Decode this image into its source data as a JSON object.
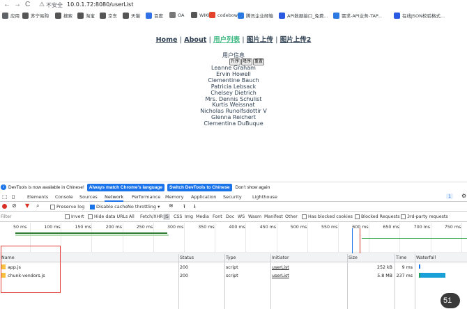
{
  "browser": {
    "nav": {
      "back": "←",
      "forward": "→",
      "reload": "C"
    },
    "security_label": "不安全",
    "url": "10.0.1.72:8080/userList",
    "bookmarks": [
      {
        "label": "应用",
        "color": "#5f6368"
      },
      {
        "label": "苏宁易购",
        "color": "#555"
      },
      {
        "label": "搜索",
        "color": "#555"
      },
      {
        "label": "淘宝",
        "color": "#555"
      },
      {
        "label": "京东",
        "color": "#555"
      },
      {
        "label": "天猫",
        "color": "#555"
      },
      {
        "label": "百度",
        "color": "#3072e6"
      },
      {
        "label": "OA",
        "color": "#777"
      },
      {
        "label": "WIKI",
        "color": "#555"
      },
      {
        "label": "codebowl",
        "color": "#e2432a"
      },
      {
        "label": "腾讯企业邮箱",
        "color": "#2a7ae2"
      },
      {
        "label": "API数据接口_免费...",
        "color": "#2a5ae2"
      },
      {
        "label": "需求-API业务-TAP...",
        "color": "#2a7ae2"
      },
      {
        "label": "在线JSON校验格式...",
        "color": "#2a5ae2"
      }
    ]
  },
  "page": {
    "nav": [
      {
        "label": "Home",
        "active": false
      },
      {
        "label": "About",
        "active": false
      },
      {
        "label": "用户列表",
        "active": true
      },
      {
        "label": "图片上传",
        "active": false
      },
      {
        "label": "图片上传2",
        "active": false
      }
    ],
    "nav_separator": "|",
    "user_title": "用户信息",
    "buttons": [
      "升序",
      "降序",
      "重置"
    ],
    "users": [
      "Leanne Graham",
      "Ervin Howell",
      "Clementine Bauch",
      "Patricia Lebsack",
      "Chelsey Dietrich",
      "Mrs. Dennis Schulist",
      "Kurtis Weissnat",
      "Nicholas Runolfsdottir V",
      "Glenna Reichert",
      "Clementina DuBuque"
    ]
  },
  "notice": {
    "text": "DevTools is now available in Chinese!",
    "btn_match": "Always match Chrome's language",
    "btn_switch": "Switch DevTools to Chinese",
    "dont_show": "Don't show again"
  },
  "devtools": {
    "tabs": [
      "Elements",
      "Console",
      "Sources",
      "Network",
      "Performance",
      "Memory",
      "Application",
      "Security",
      "Lighthouse"
    ],
    "active_tab": "Network",
    "messages_count": "1",
    "toolbar": {
      "preserve_log": "Preserve log",
      "disable_cache": "Disable cache",
      "throttle": "No throttling"
    },
    "filter": {
      "label": "Filter",
      "invert": "Invert",
      "hide_data_urls": "Hide data URLs",
      "types": [
        "All",
        "Fetch/XHR",
        "JS",
        "CSS",
        "Img",
        "Media",
        "Font",
        "Doc",
        "WS",
        "Wasm",
        "Manifest",
        "Other"
      ],
      "active_type": "JS",
      "blocked_cookies": "Has blocked cookies",
      "blocked_requests": "Blocked Requests",
      "third_party": "3rd-party requests"
    },
    "timeline_ticks": [
      "50 ms",
      "100 ms",
      "150 ms",
      "200 ms",
      "250 ms",
      "300 ms",
      "350 ms",
      "400 ms",
      "450 ms",
      "500 ms",
      "550 ms",
      "600 ms",
      "650 ms",
      "700 ms",
      "750 ms"
    ],
    "columns": [
      "Name",
      "Status",
      "Type",
      "Initiator",
      "Size",
      "Time",
      "Waterfall"
    ],
    "requests": [
      {
        "name": "app.js",
        "status": "200",
        "type": "script",
        "initiator": "userList",
        "size": "252 kB",
        "time": "9 ms"
      },
      {
        "name": "chunk-vendors.js",
        "status": "200",
        "type": "script",
        "initiator": "userList",
        "size": "5.8 MB",
        "time": "237 ms"
      }
    ]
  },
  "overlay_badge": "51"
}
